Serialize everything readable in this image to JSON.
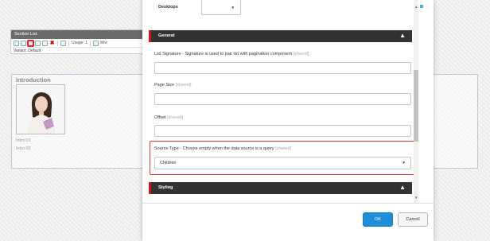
{
  "background": {
    "toolbar": {
      "title": "Section List",
      "usage": "Usage: 1",
      "more": "Mor",
      "variant": "Variant:  Default"
    },
    "section": {
      "title": "Introduction",
      "items": [
        "Intro 01",
        "Intro 02"
      ]
    }
  },
  "dialog": {
    "top_field": {
      "label": "Desktops",
      "value": ""
    },
    "general_panel": {
      "title": "General"
    },
    "fields": {
      "list_signature": {
        "label": "List Signature - Signature is used to pair list with pagination component",
        "shared": "[shared]",
        "value": ""
      },
      "page_size": {
        "label": "Page Size",
        "shared": "[shared]",
        "value": ""
      },
      "offset": {
        "label": "Offset",
        "shared": "[shared]",
        "value": ""
      },
      "source_type": {
        "label": "Source Type - Choose empty when the data source is a query",
        "shared": "[shared]",
        "value": "Children"
      }
    },
    "styling_panel": {
      "title": "Styling"
    },
    "buttons": {
      "ok": "OK",
      "cancel": "Cancel"
    }
  },
  "colors": {
    "panel_header": "#333333",
    "accent_red": "#d11111",
    "ok_button": "#1f8ed8",
    "scroll_marker": "#54b4c0"
  },
  "icons": {
    "chevron_up": "▲",
    "caret_down": "▼"
  }
}
